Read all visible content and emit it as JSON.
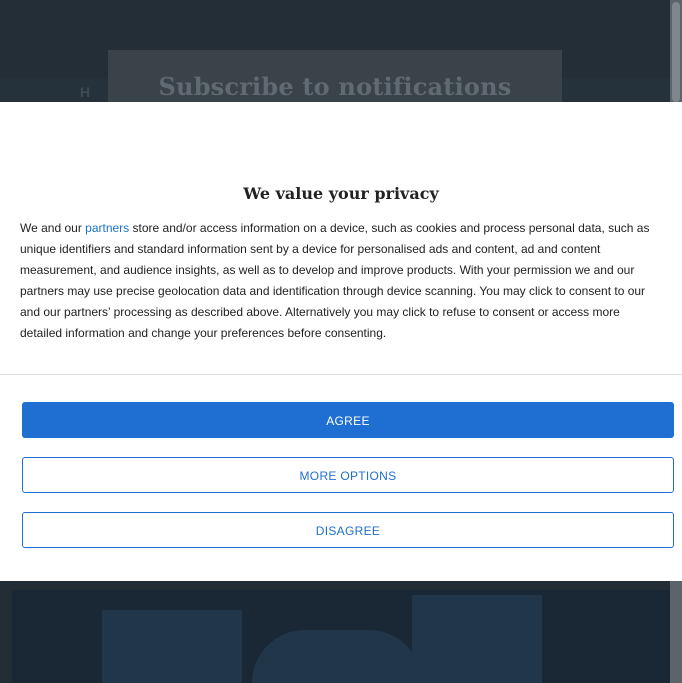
{
  "background": {
    "subscribe_title": "Subscribe to notifications",
    "nav_glyph": "H"
  },
  "consent": {
    "title": "We value your privacy",
    "body_prefix": "We and our ",
    "partners_link": "partners",
    "body_suffix": " store and/or access information on a device, such as cookies and process personal data, such as unique identifiers and standard information sent by a device for personalised ads and content, ad and content measurement, and audience insights, as well as to develop and improve products. With your permission we and our partners may use precise geolocation data and identification through device scanning. You may click to consent to our and our partners’ processing as described above. Alternatively you may click to refuse to consent or access more detailed information and change your preferences before consenting.",
    "buttons": {
      "agree": "AGREE",
      "more_options": "MORE OPTIONS",
      "disagree": "DISAGREE"
    }
  },
  "colors": {
    "accent": "#1f6fd2",
    "link": "#1a73c9",
    "overlay_dark": "#222d36"
  }
}
